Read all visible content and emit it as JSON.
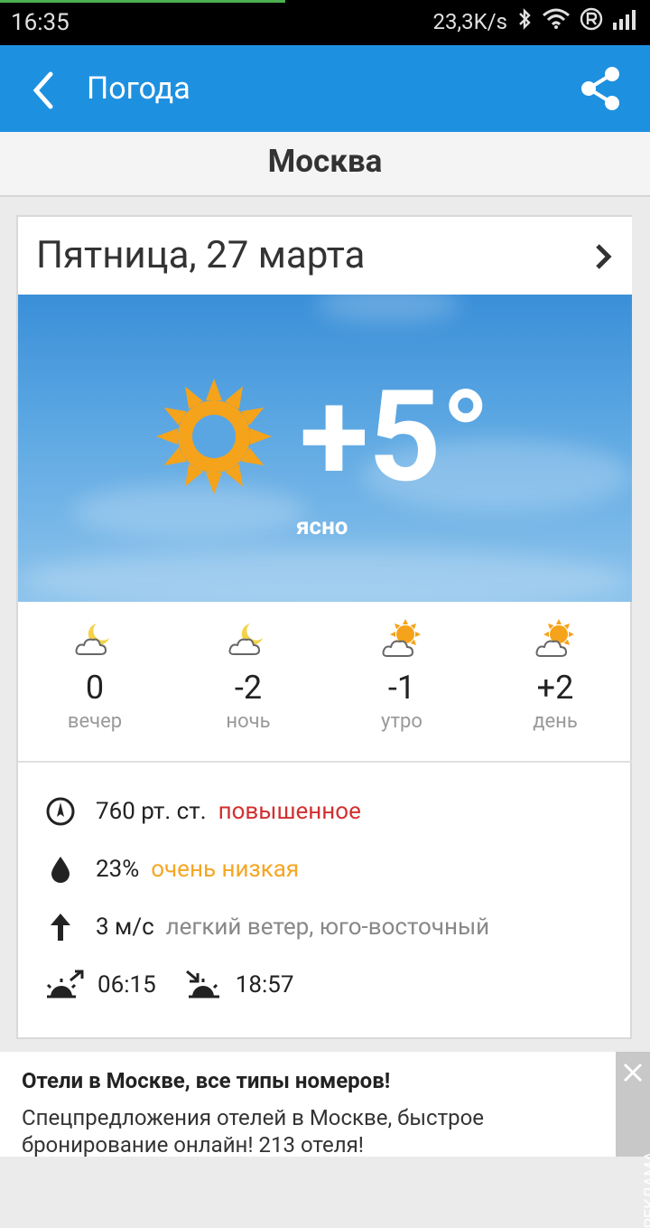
{
  "status": {
    "time": "16:35",
    "speed": "23,3K/s",
    "icons": [
      "bluetooth-icon",
      "wifi-icon",
      "registered-icon",
      "signal-icon"
    ]
  },
  "appbar": {
    "title": "Погода"
  },
  "city": "Москва",
  "day": {
    "date": "Пятница, 27 марта"
  },
  "current": {
    "temp": "+5°",
    "condition": "ясно"
  },
  "periods": [
    {
      "value": "0",
      "label": "вечер",
      "icon": "moon-cloud-icon"
    },
    {
      "value": "-2",
      "label": "ночь",
      "icon": "moon-cloud-icon"
    },
    {
      "value": "-1",
      "label": "утро",
      "icon": "sun-cloud-icon"
    },
    {
      "value": "+2",
      "label": "день",
      "icon": "sun-cloud-icon"
    }
  ],
  "details": {
    "pressure": {
      "value": "760 рт. ст.",
      "note": "повышенное"
    },
    "humidity": {
      "value": "23%",
      "note": "очень низкая"
    },
    "wind": {
      "value": "3 м/с",
      "desc": "легкий ветер,",
      "dir": "юго-восточный"
    },
    "sunrise": "06:15",
    "sunset": "18:57"
  },
  "ad": {
    "title": "Отели в Москве, все типы номеров!",
    "text": "Спецпредложения отелей в Москве, быстрое бронирование онлайн! 213 отеля!",
    "side_label": "РЕКЛАМА"
  },
  "colors": {
    "appbar": "#1e90e0",
    "pressure_note": "#d32f2f",
    "humidity_note": "#f5a623",
    "sun": "#f5a31a"
  }
}
